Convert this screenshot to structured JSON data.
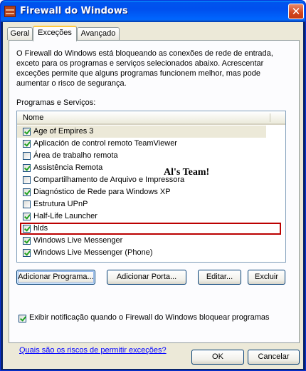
{
  "window": {
    "title": "Firewall do Windows",
    "close_label": "✕"
  },
  "tabs": [
    {
      "label": "Geral"
    },
    {
      "label": "Exceções",
      "active": true
    },
    {
      "label": "Avançado"
    }
  ],
  "description": "O Firewall do Windows está bloqueando as conexões de rede de entrada, exceto para os programas e serviços selecionados abaixo. Acrescentar exceções permite que alguns programas funcionem melhor, mas pode aumentar o risco de segurança.",
  "list": {
    "section_label": "Programas e Serviços:",
    "column_header": "Nome",
    "items": [
      {
        "label": "Age of Empires 3",
        "checked": true
      },
      {
        "label": "Aplicación de control remoto TeamViewer",
        "checked": true
      },
      {
        "label": "Área de trabalho remota",
        "checked": false
      },
      {
        "label": "Assistência Remota",
        "checked": true
      },
      {
        "label": "Compartilhamento de Arquivo e Impressora",
        "checked": false
      },
      {
        "label": "Diagnóstico de Rede para Windows XP",
        "checked": true
      },
      {
        "label": "Estrutura UPnP",
        "checked": false
      },
      {
        "label": "Half-Life Launcher",
        "checked": true
      },
      {
        "label": "hlds",
        "checked": true
      },
      {
        "label": "Windows Live Messenger",
        "checked": true
      },
      {
        "label": "Windows Live Messenger (Phone)",
        "checked": true
      }
    ]
  },
  "annotation": "Al's Team!",
  "buttons": {
    "add_program": "Adicionar Programa...",
    "add_port": "Adicionar Porta...",
    "edit": "Editar...",
    "delete": "Excluir",
    "ok": "OK",
    "cancel": "Cancelar"
  },
  "notify": {
    "label": "Exibir notificação quando o Firewall do Windows bloquear programas",
    "checked": true
  },
  "risk_link": "Quais são os riscos de permitir exceções?",
  "colors": {
    "title_bar": "#0053ee",
    "dialog_bg": "#ece9d8",
    "highlight_border": "#bb0000",
    "link": "#0000ff"
  }
}
